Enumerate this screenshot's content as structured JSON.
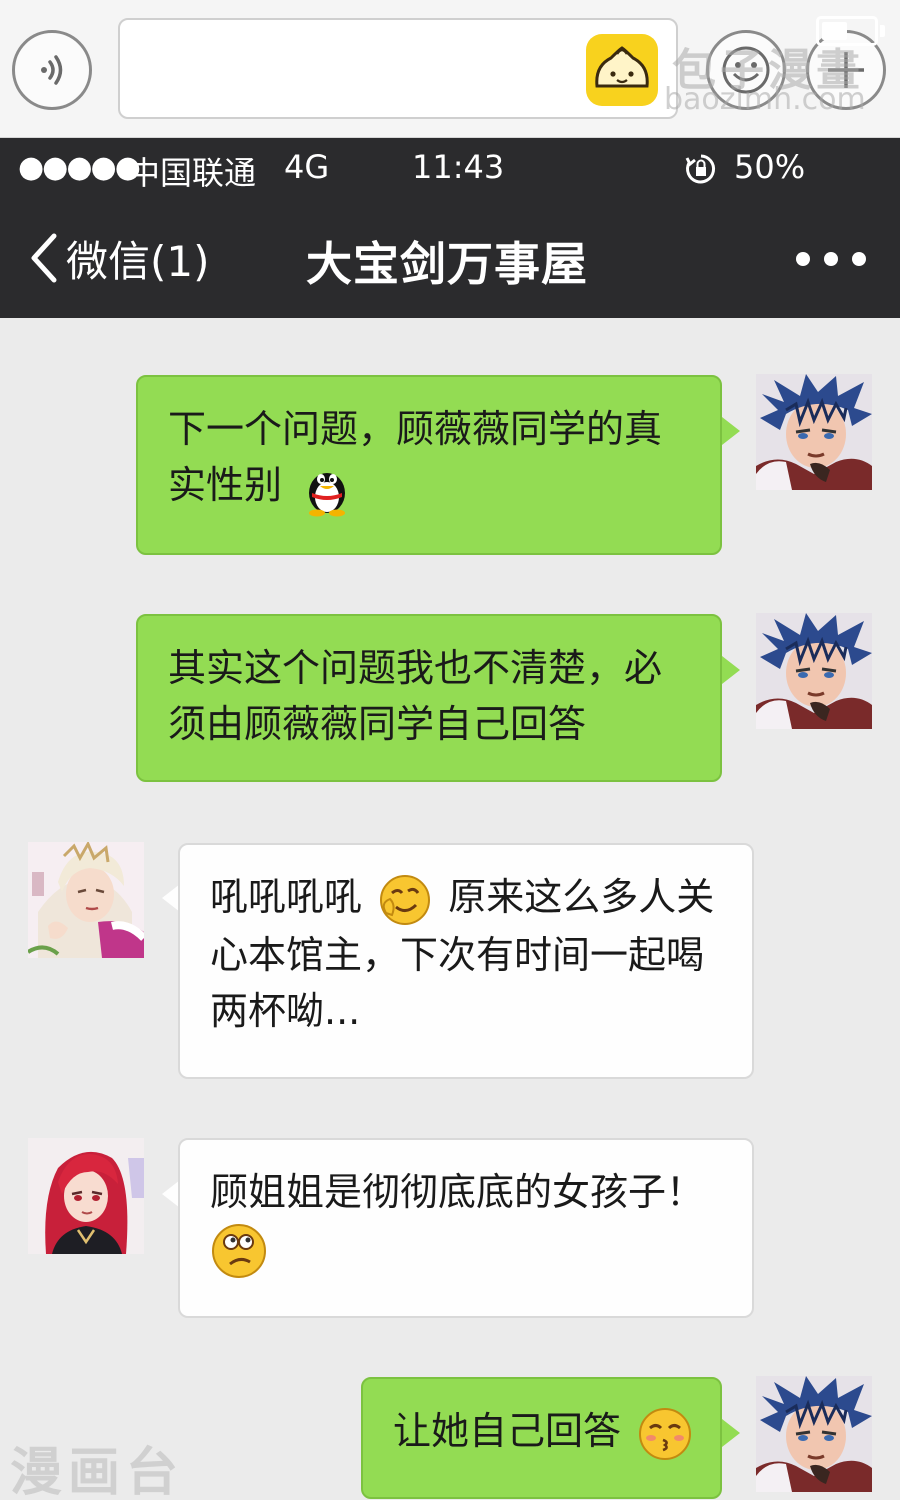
{
  "input_bar": {
    "text_value": "",
    "watermark_main": "包子漫畫",
    "watermark_sub": "baozimh.com"
  },
  "status_bar": {
    "signal": "●●●●●",
    "carrier": "中国联通",
    "network": "4G",
    "time": "11:43",
    "battery_percent": "50%",
    "battery_level": 0.5
  },
  "nav": {
    "back_label": "微信(1)",
    "title": "大宝剑万事屋"
  },
  "messages": [
    {
      "direction": "sent",
      "sender": "blue-haired-boy",
      "lines": [
        "下一个问题，顾薇薇同学的真",
        "实性别"
      ],
      "emoji": "penguin"
    },
    {
      "direction": "sent",
      "sender": "blue-haired-boy",
      "lines": [
        "其实这个问题我也不清楚，必",
        "须由顾薇薇同学自己回答"
      ]
    },
    {
      "direction": "received",
      "sender": "white-haired-owner",
      "line1_before": "吼吼吼吼",
      "line1_after": "原来这么多人关",
      "lines_rest": [
        "心本馆主，下次有时间一起喝",
        "两杯呦..."
      ],
      "emoji": "sly-face"
    },
    {
      "direction": "received",
      "sender": "red-haired-girl",
      "lines": [
        "顾姐姐是彻彻底底的女孩子！"
      ],
      "emoji": "confused-face"
    },
    {
      "direction": "sent",
      "sender": "blue-haired-boy",
      "lines": [
        "让她自己回答"
      ],
      "emoji": "kissing-face"
    }
  ],
  "watermark_bottom": "漫画台",
  "colors": {
    "sent_bubble": "#93dc53",
    "received_bubble": "#fefefe",
    "header": "#2b2b2d",
    "chat_bg": "#ebebeb"
  }
}
